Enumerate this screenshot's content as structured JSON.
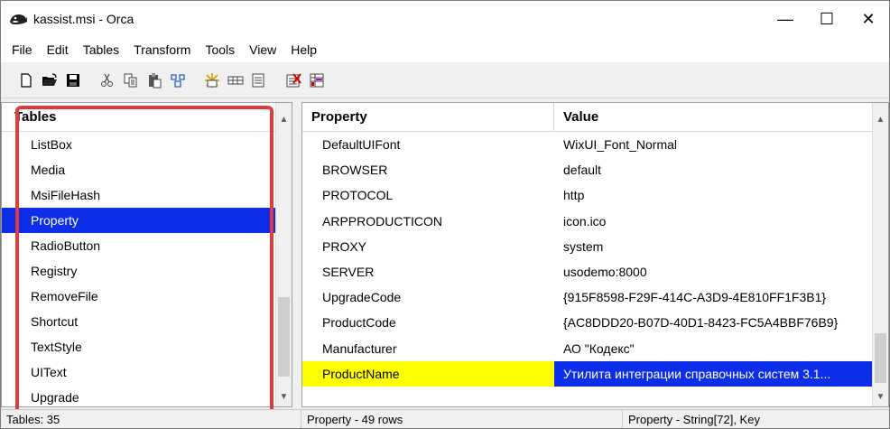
{
  "window": {
    "title": "kassist.msi - Orca",
    "controls": {
      "minimize": "—",
      "maximize": "☐",
      "close": "✕"
    }
  },
  "menu": [
    "File",
    "Edit",
    "Tables",
    "Transform",
    "Tools",
    "View",
    "Help"
  ],
  "toolbar": {
    "buttons": [
      "new-file-icon",
      "open-folder-icon",
      "save-disk-icon",
      "cut-icon",
      "copy-icon",
      "paste-icon",
      "find-icon",
      "add-table-icon",
      "add-row-icon",
      "drop-table-icon",
      "validate-icon",
      "merge-module-icon"
    ]
  },
  "tables_pane": {
    "header": "Tables",
    "items": [
      "ListBox",
      "Media",
      "MsiFileHash",
      "Property",
      "RadioButton",
      "Registry",
      "RemoveFile",
      "Shortcut",
      "TextStyle",
      "UIText",
      "Upgrade"
    ],
    "selected": "Property"
  },
  "property_table": {
    "columns": [
      "Property",
      "Value"
    ],
    "rows": [
      {
        "property": "DefaultUIFont",
        "value": "WixUI_Font_Normal"
      },
      {
        "property": "BROWSER",
        "value": "default"
      },
      {
        "property": "PROTOCOL",
        "value": "http"
      },
      {
        "property": "ARPPRODUCTICON",
        "value": "icon.ico"
      },
      {
        "property": "PROXY",
        "value": "system"
      },
      {
        "property": "SERVER",
        "value": "usodemo:8000"
      },
      {
        "property": "UpgradeCode",
        "value": "{915F8598-F29F-414C-A3D9-4E810FF1F3B1}"
      },
      {
        "property": "ProductCode",
        "value": "{AC8DDD20-B07D-40D1-8423-FC5A4BBF76B9}"
      },
      {
        "property": "Manufacturer",
        "value": "АО \"Кодекс\""
      },
      {
        "property": "ProductName",
        "value": "Утилита интеграции справочных систем 3.1..."
      }
    ],
    "selected_row": "ProductName"
  },
  "status": {
    "tables_count": "Tables: 35",
    "rows": "Property - 49 rows",
    "column_info": "Property - String[72], Key"
  },
  "colors": {
    "selection": "#0c2ee9",
    "highlight": "#ffff00",
    "annotation": "#e23b3b"
  }
}
